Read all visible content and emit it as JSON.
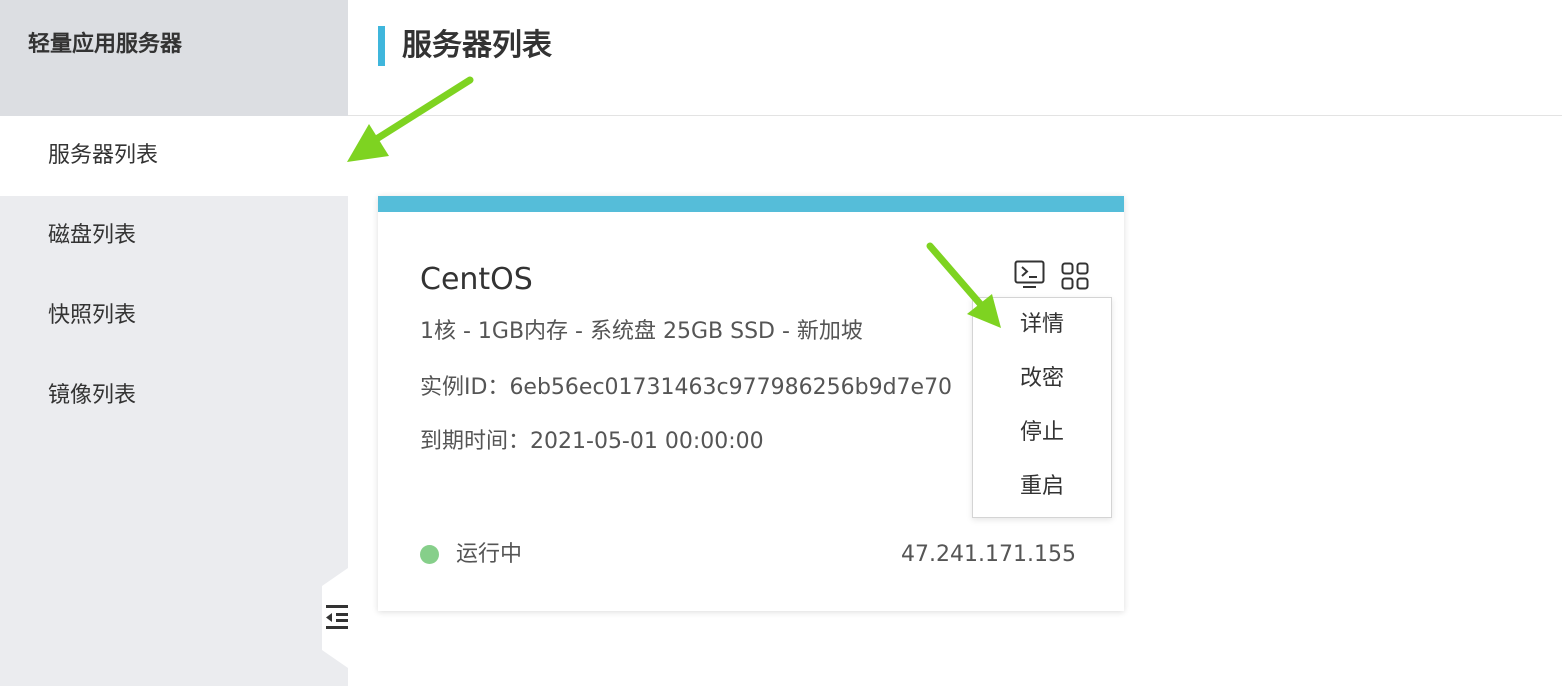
{
  "sidebar": {
    "title": "轻量应用服务器",
    "items": [
      {
        "label": "服务器列表",
        "active": true
      },
      {
        "label": "磁盘列表",
        "active": false
      },
      {
        "label": "快照列表",
        "active": false
      },
      {
        "label": "镜像列表",
        "active": false
      }
    ],
    "collapse_icon": "collapse-menu-icon"
  },
  "header": {
    "title": "服务器列表",
    "accent_color": "#3fb6dc"
  },
  "server_card": {
    "os": "CentOS",
    "spec": "1核 - 1GB内存 - 系统盘 25GB SSD - 新加坡",
    "instance_id_label": "实例ID：",
    "instance_id": "6eb56ec01731463c977986256b9d7e70",
    "expiry_label": "到期时间：",
    "expiry": "2021-05-01 00:00:00",
    "status": "运行中",
    "status_color": "#86cf8a",
    "ip": "47.241.171.155",
    "top_bar_color": "#55bdd9",
    "actions": {
      "terminal_icon": "terminal-icon",
      "more_icon": "grid-menu-icon"
    }
  },
  "dropdown_menu": {
    "items": [
      "详情",
      "改密",
      "停止",
      "重启"
    ]
  },
  "annotation": {
    "arrow_color": "#7ed321"
  }
}
